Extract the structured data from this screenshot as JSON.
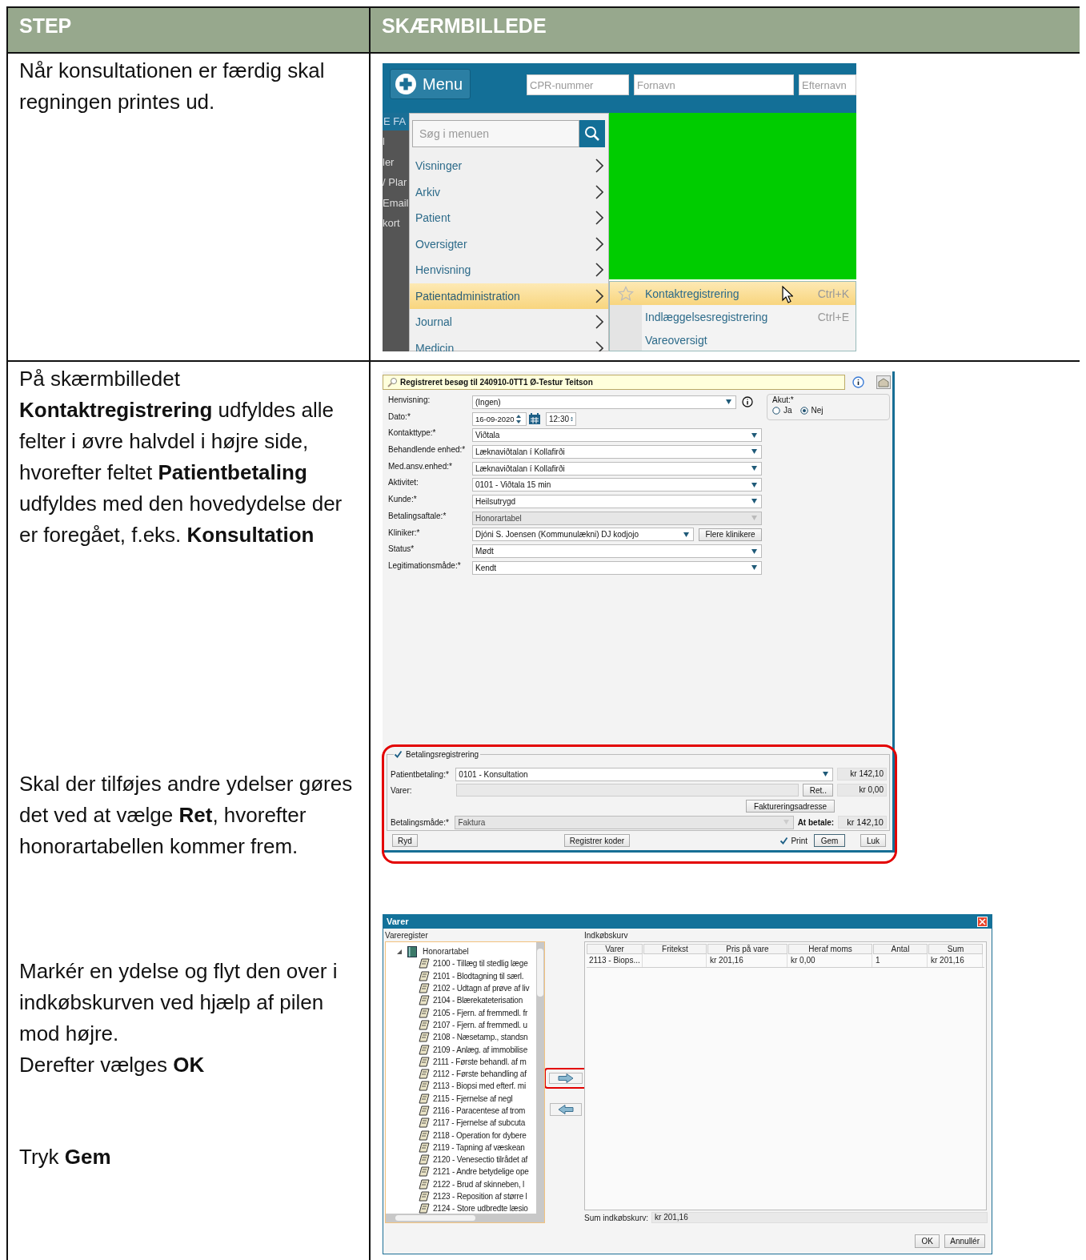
{
  "table": {
    "columns": [
      "STEP",
      "SKÆRMBILLEDE"
    ],
    "rows": [
      {
        "step": [
          "Når konsultationen er færdig skal regningen printes ud."
        ],
        "screenshots": [
          {
            "kind": "menu",
            "menu_button": "Menu",
            "search_fields": [
              {
                "placeholder": "CPR-nummer"
              },
              {
                "placeholder": "Fornavn"
              },
              {
                "placeholder": "Efternavn"
              }
            ],
            "sidebar_header": "E FA",
            "sidebar_items": [
              "l",
              "ler",
              "/ Plar",
              "Email",
              "kort"
            ],
            "menu_search": {
              "placeholder": "Søg i menuen"
            },
            "menu_items": [
              {
                "label": "Visninger",
                "selected": false
              },
              {
                "label": "Arkiv",
                "selected": false
              },
              {
                "label": "Patient",
                "selected": false
              },
              {
                "label": "Oversigter",
                "selected": false
              },
              {
                "label": "Henvisning",
                "selected": false
              },
              {
                "label": "Patientadministration",
                "selected": true
              },
              {
                "label": "Journal",
                "selected": false
              },
              {
                "label": "Medicin",
                "selected": false
              }
            ],
            "submenu_items": [
              {
                "label": "Kontaktregistrering",
                "shortcut": "Ctrl+K",
                "selected": true
              },
              {
                "label": "Indlæggelsesregistrering",
                "shortcut": "Ctrl+E",
                "selected": false
              },
              {
                "label": "Vareoversigt",
                "selected": false
              }
            ]
          }
        ]
      },
      {
        "step": [
          "På skærmbilledet **Kontaktregistrering** udfyldes alle felter i øvre halvdel i højre side, hvorefter feltet **Patientbetaling** udfyldes med den hovedydelse der er foregået, f.eks. **Konsultation**",
          "Skal der tilføjes andre ydelser gøres det ved at vælge **Ret**, hvorefter honorartabellen kommer frem.",
          "Markér en ydelse og flyt den over i indkøbskurven ved hjælp af pilen mod højre.",
          "Derefter vælges **OK**",
          "Tryk **Gem**"
        ],
        "screenshots": [
          {
            "kind": "form",
            "title": "Registreret besøg til 240910-0TT1 Ø-Testur Teitson",
            "fields": [
              {
                "label": "Henvisning:",
                "kind": "select-info",
                "value": "(Ingen)",
                "disabled": false
              },
              {
                "label": "Dato:*",
                "kind": "datetime",
                "date": "16-09-2020",
                "time": "12:30",
                "disabled": false
              },
              {
                "label": "Kontakttype:*",
                "kind": "select",
                "value": "Viðtala",
                "disabled": false
              },
              {
                "label": "Behandlende enhed:*",
                "kind": "select",
                "value": "Læknaviðtalan í Kollafirði",
                "disabled": false
              },
              {
                "label": "Med.ansv.enhed:*",
                "kind": "select",
                "value": "Læknaviðtalan í Kollafirði",
                "disabled": false
              },
              {
                "label": "Aktivitet:",
                "kind": "select",
                "value": "0101 - Viðtala 15 min",
                "disabled": false
              },
              {
                "label": "Kunde:*",
                "kind": "select",
                "value": "Heilsutrygd",
                "disabled": false
              },
              {
                "label": "Betalingsaftale:*",
                "kind": "select",
                "value": "Honorartabel",
                "disabled": true
              },
              {
                "label": "Kliniker:*",
                "kind": "select-button",
                "value": "Djóni S. Joensen (Kommunulækni) DJ kodjojo",
                "button": "Flere klinikere",
                "disabled": false
              },
              {
                "label": "Status*",
                "kind": "select",
                "value": "Mødt",
                "disabled": false
              },
              {
                "label": "Legitimationsmåde:*",
                "kind": "select",
                "value": "Kendt",
                "disabled": false
              }
            ],
            "akut": {
              "label": "Akut:*",
              "options": [
                {
                  "label": "Ja",
                  "selected": false
                },
                {
                  "label": "Nej",
                  "selected": true
                }
              ]
            },
            "payment": {
              "label": "Betalingsregistrering",
              "checked": true,
              "highlighted": true,
              "patientbetaling": {
                "label": "Patientbetaling:*",
                "value": "0101 - Konsultation",
                "amount": "kr 142,10"
              },
              "varer": {
                "label": "Varer:",
                "button": "Ret..",
                "amount": "kr 0,00"
              },
              "address_button": "Faktureringsadresse",
              "betalingsmaade": {
                "label": "Betalingsmåde:*",
                "value": "Faktura"
              },
              "at_betale": {
                "label": "At betale:",
                "amount": "kr 142,10"
              }
            },
            "buttons": {
              "clear": "Ryd",
              "codes": "Registrer koder",
              "print": {
                "label": "Print",
                "checked": true
              },
              "save": "Gem",
              "close": "Luk"
            }
          },
          {
            "kind": "dialog",
            "title": "Varer",
            "register_label": "Vareregister",
            "tree": [
              {
                "label": "Honorartabel",
                "expanded": true,
                "children": [
                  {
                    "label": "2100 - Tillæg til stedlig læge"
                  },
                  {
                    "label": "2101 - Blodtagning til særl."
                  },
                  {
                    "label": "2102 - Udtagn af prøve af liv"
                  },
                  {
                    "label": "2104 - Blærekateterisation"
                  },
                  {
                    "label": "2105 - Fjern. af fremmedl. fr"
                  },
                  {
                    "label": "2107 - Fjern. af fremmedl. u"
                  },
                  {
                    "label": "2108 - Næsetamp., standsn"
                  },
                  {
                    "label": "2109 - Anlæg. af immobilise"
                  },
                  {
                    "label": "2111 - Første behandl. af m"
                  },
                  {
                    "label": "2112 - Første behandling af"
                  },
                  {
                    "label": "2113 - Biopsi med efterf. mi"
                  },
                  {
                    "label": "2115 - Fjernelse af negl"
                  },
                  {
                    "label": "2116 - Paracentese af trom"
                  },
                  {
                    "label": "2117 - Fjernelse af subcuta"
                  },
                  {
                    "label": "2118 - Operation for dybere"
                  },
                  {
                    "label": "2119 - Tapning af væskean"
                  },
                  {
                    "label": "2120 - Venesectio tilrådet af"
                  },
                  {
                    "label": "2121 - Andre betydelige ope"
                  },
                  {
                    "label": "2122 - Brud af skinneben, l"
                  },
                  {
                    "label": "2123 - Reposition af større l"
                  },
                  {
                    "label": "2124 - Store udbredte læsio"
                  }
                ]
              }
            ],
            "transfer_buttons": [
              {
                "kind": "right",
                "highlighted": true
              },
              {
                "kind": "left",
                "highlighted": false
              }
            ],
            "basket_label": "Indkøbskurv",
            "basket": {
              "columns": [
                "Varer",
                "Fritekst",
                "Pris på vare",
                "Heraf moms",
                "Antal",
                "Sum"
              ],
              "rows": [
                [
                  "2113 - Biops...",
                  null,
                  "kr 201,16",
                  "kr 0,00",
                  "1",
                  "kr 201,16"
                ]
              ]
            },
            "sum_label": "Sum indkøbskurv:",
            "sum_value": "kr 201,16",
            "buttons": [
              "OK",
              "Annullér"
            ]
          }
        ]
      }
    ]
  }
}
